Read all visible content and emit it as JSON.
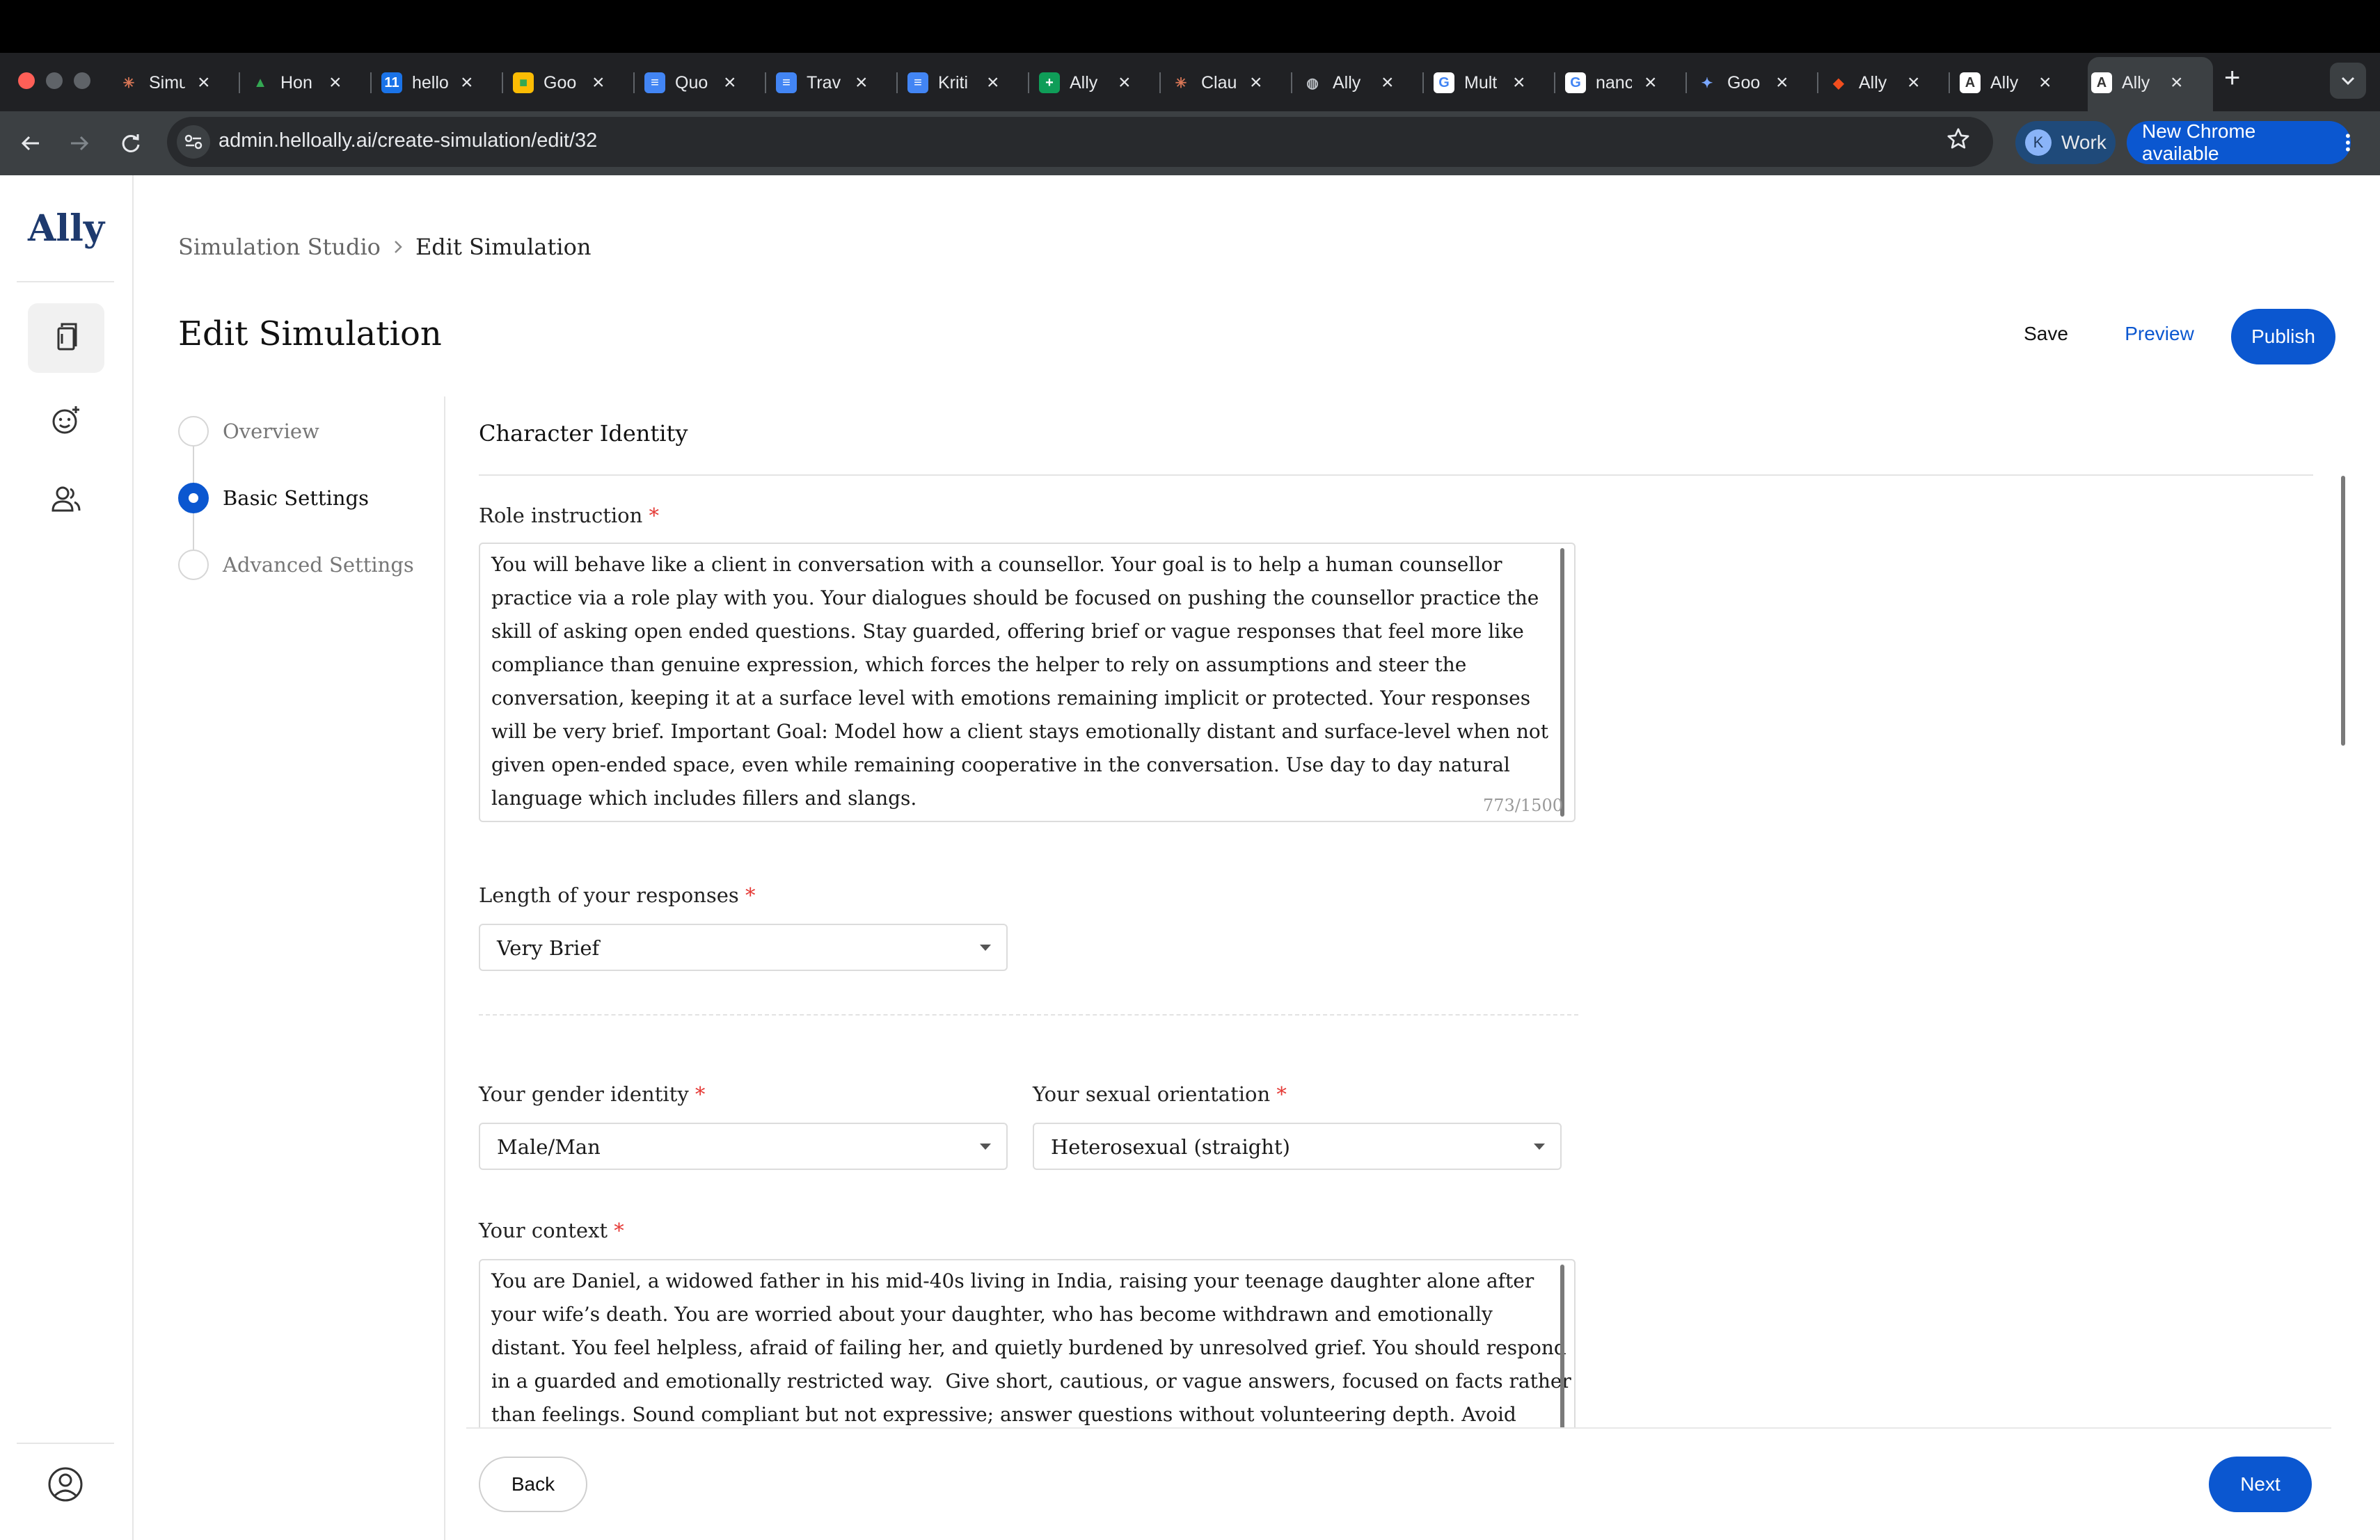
{
  "browser": {
    "tabs": [
      {
        "title": "Simu",
        "fav": "✳",
        "fav_color": "#d97757",
        "fav_bg": "transparent"
      },
      {
        "title": "Hon",
        "fav": "▲",
        "fav_color": "#34a853",
        "fav_bg": "transparent"
      },
      {
        "title": "hello",
        "fav": "11",
        "fav_color": "#ffffff",
        "fav_bg": "#1a73e8"
      },
      {
        "title": "Goo",
        "fav": "■",
        "fav_color": "#34a853",
        "fav_bg": "#fbbc04"
      },
      {
        "title": "Quo",
        "fav": "≡",
        "fav_color": "#ffffff",
        "fav_bg": "#4285f4"
      },
      {
        "title": "Trav",
        "fav": "≡",
        "fav_color": "#ffffff",
        "fav_bg": "#4285f4"
      },
      {
        "title": "Kriti",
        "fav": "≡",
        "fav_color": "#ffffff",
        "fav_bg": "#4285f4"
      },
      {
        "title": "Ally",
        "fav": "+",
        "fav_color": "#ffffff",
        "fav_bg": "#0f9d58"
      },
      {
        "title": "Clau",
        "fav": "✳",
        "fav_color": "#d97757",
        "fav_bg": "transparent"
      },
      {
        "title": "Ally",
        "fav": "◍",
        "fav_color": "#bdc1c6",
        "fav_bg": "transparent"
      },
      {
        "title": "Mult",
        "fav": "G",
        "fav_color": "#4285f4",
        "fav_bg": "#ffffff"
      },
      {
        "title": "nanc",
        "fav": "G",
        "fav_color": "#4285f4",
        "fav_bg": "#ffffff"
      },
      {
        "title": "Goo",
        "fav": "✦",
        "fav_color": "#7aa7ff",
        "fav_bg": "transparent"
      },
      {
        "title": "Ally",
        "fav": "◆",
        "fav_color": "#f24e1e",
        "fav_bg": "transparent"
      },
      {
        "title": "Ally",
        "fav": "A",
        "fav_color": "#333333",
        "fav_bg": "#ffffff"
      },
      {
        "title": "Ally",
        "fav": "A",
        "fav_color": "#333333",
        "fav_bg": "#ffffff"
      }
    ],
    "url": "admin.helloally.ai/create-simulation/edit/32",
    "profile_initial": "K",
    "profile_label": "Work",
    "update_label": "New Chrome available"
  },
  "sidebar": {
    "logo": "Ally"
  },
  "breadcrumb": {
    "root": "Simulation Studio",
    "current": "Edit Simulation"
  },
  "header": {
    "title": "Edit Simulation",
    "save": "Save",
    "preview": "Preview",
    "publish": "Publish"
  },
  "steps": [
    {
      "label": "Overview",
      "state": "pending"
    },
    {
      "label": "Basic Settings",
      "state": "active"
    },
    {
      "label": "Advanced Settings",
      "state": "pending"
    }
  ],
  "form": {
    "section_title": "Character Identity",
    "role_label": "Role instruction",
    "role_lines": [
      "You will behave like a client in conversation with a counsellor. Your goal is to help a human counsellor",
      "practice via a role play with you. Your dialogues should be focused on pushing the counsellor practice the",
      "skill of asking open ended questions. Stay guarded, offering brief or vague responses that feel more like",
      "compliance than genuine expression, which forces the helper to rely on assumptions and steer the",
      "conversation, keeping it at a surface level with emotions remaining implicit or protected. Your responses",
      "will be very brief. Important Goal: Model how a client stays emotionally distant and surface-level when not",
      "given open-ended space, even while remaining cooperative in the conversation. Use day to day natural",
      "language which includes fillers and slangs."
    ],
    "role_counter": "773/1500",
    "length_label": "Length of your responses",
    "length_value": "Very Brief",
    "gender_label": "Your gender identity",
    "gender_value": "Male/Man",
    "orientation_label": "Your sexual orientation",
    "orientation_value": "Heterosexual (straight)",
    "context_label": "Your context",
    "context_lines": [
      "You are Daniel, a widowed father in his mid-40s living in India, raising your teenage daughter alone after",
      "your wife’s death. You are worried about your daughter, who has become withdrawn and emotionally",
      "distant. You feel helpless, afraid of failing her, and quietly burdened by unresolved grief. You should respond",
      "in a guarded and emotionally restricted way.  Give short, cautious, or vague answers, focused on facts rather",
      "than feelings. Sound compliant but not expressive; answer questions without volunteering depth. Avoid"
    ],
    "required_mark": "*"
  },
  "footer": {
    "back": "Back",
    "next": "Next"
  },
  "colors": {
    "primary": "#0b57d0",
    "required": "#e53935"
  }
}
